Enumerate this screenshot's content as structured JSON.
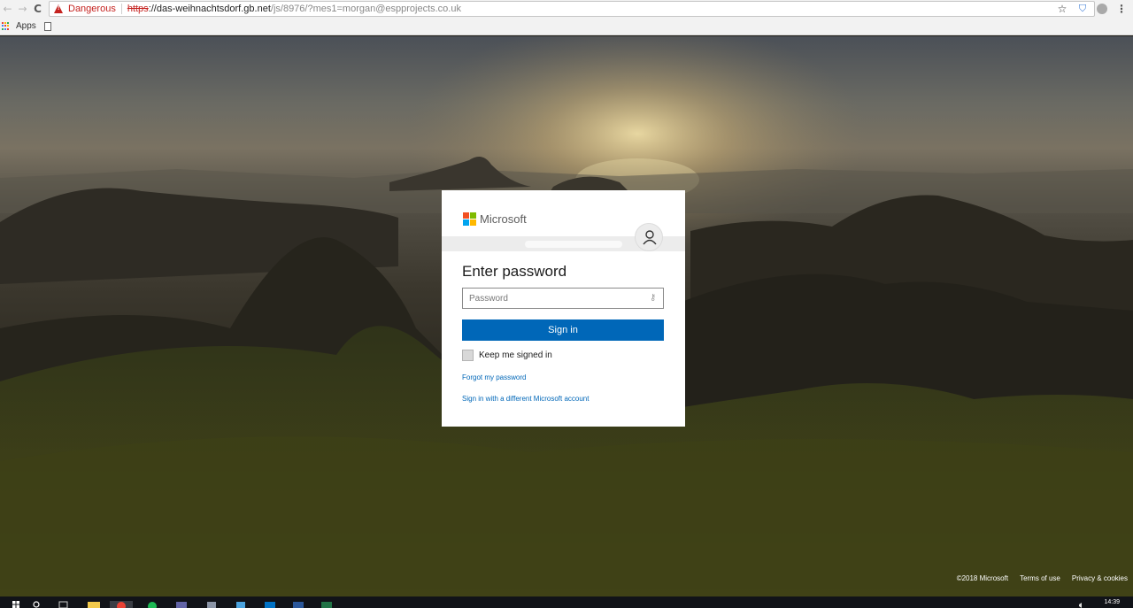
{
  "browser": {
    "security_label": "Dangerous",
    "url_scheme": "https",
    "url_host": "://das-weihnachtsdorf.gb.net",
    "url_rest": "/js/8976/?mes1=morgan@espprojects.co.uk",
    "bookmarks": {
      "apps_label": "Apps"
    },
    "icons": [
      "back-icon",
      "forward-icon",
      "reload-icon",
      "warning-icon",
      "star-icon",
      "shield-icon",
      "extension-icon",
      "menu-icon",
      "apps-grid-icon",
      "page-icon"
    ]
  },
  "signin": {
    "logo_text": "Microsoft",
    "title": "Enter password",
    "password_placeholder": "Password",
    "password_value": "",
    "signin_button": "Sign in",
    "keep_signed_in": "Keep me signed in",
    "forgot_link": "Forgot my password",
    "different_account_link": "Sign in with a different Microsoft account",
    "colors": {
      "primary": "#0067b8",
      "ms_red": "#f25022",
      "ms_green": "#7fba00",
      "ms_blue": "#00a4ef",
      "ms_yellow": "#ffb900"
    }
  },
  "footer": {
    "copyright": "©2018 Microsoft",
    "terms": "Terms of use",
    "privacy": "Privacy & cookies"
  },
  "taskbar": {
    "clock": "14:39"
  }
}
